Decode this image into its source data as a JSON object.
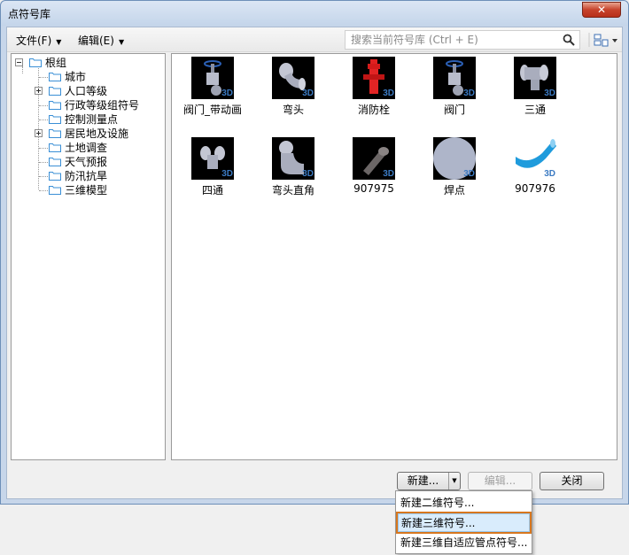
{
  "window": {
    "title": "点符号库",
    "close_label": "✕"
  },
  "toolbar": {
    "file_menu": "文件(F)",
    "edit_menu": "编辑(E)",
    "search_placeholder": "搜索当前符号库 (Ctrl + E)"
  },
  "tree": {
    "root": "根组",
    "items": [
      "城市",
      "人口等级",
      "行政等级组符号",
      "控制测量点",
      "居民地及设施",
      "土地调查",
      "天气预报",
      "防汛抗旱",
      "三维模型"
    ]
  },
  "symbols": [
    {
      "label": "阀门_带动画",
      "icon": "valve-animated-icon"
    },
    {
      "label": "弯头",
      "icon": "elbow-icon"
    },
    {
      "label": "消防栓",
      "icon": "hydrant-icon"
    },
    {
      "label": "阀门",
      "icon": "valve-icon"
    },
    {
      "label": "三通",
      "icon": "tee-icon"
    },
    {
      "label": "四通",
      "icon": "cross-icon"
    },
    {
      "label": "弯头直角",
      "icon": "elbow-right-angle-icon"
    },
    {
      "label": "907975",
      "icon": "pipe-icon"
    },
    {
      "label": "焊点",
      "icon": "weld-point-icon"
    },
    {
      "label": "907976",
      "icon": "pipe-bend-icon"
    }
  ],
  "badge_3d": "3D",
  "buttons": {
    "new": "新建...",
    "edit": "编辑...",
    "close": "关闭"
  },
  "dropdown": {
    "items": [
      "新建二维符号...",
      "新建三维符号...",
      "新建三维自适应管点符号..."
    ],
    "active_index": 1
  },
  "colors": {
    "highlight_border": "#d7771f",
    "badge": "#3b7ac2"
  }
}
